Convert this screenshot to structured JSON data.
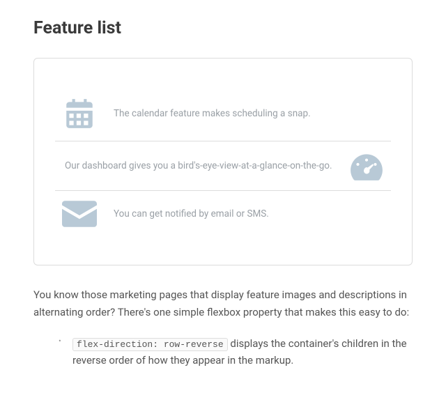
{
  "heading": "Feature list",
  "features": [
    {
      "text": "The calendar feature makes scheduling a snap."
    },
    {
      "text": "Our dashboard gives you a bird's-eye-view-at-a-glance-on-the-go."
    },
    {
      "text": "You can get notified by email or SMS."
    }
  ],
  "paragraph": "You know those marketing pages that display feature images and descriptions in alternating order? There's one simple flexbox property that makes this easy to do:",
  "bullet": {
    "code": "flex-direction: row-reverse",
    "rest": " displays the container's children in the reverse order of how they appear in the markup."
  }
}
